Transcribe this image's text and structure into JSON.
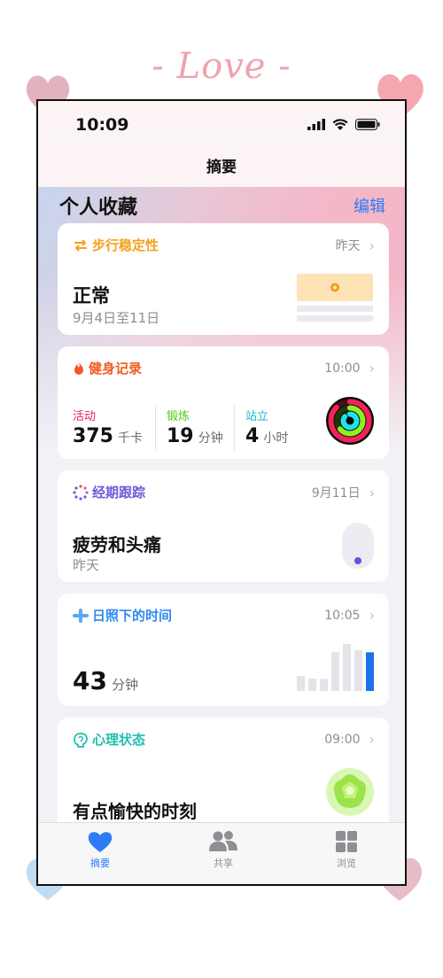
{
  "decoration": {
    "love_text": "- Love -"
  },
  "status_bar": {
    "time": "10:09"
  },
  "nav": {
    "title": "摘要"
  },
  "favorites": {
    "title": "个人收藏",
    "edit_label": "编辑"
  },
  "cards": {
    "walking": {
      "title": "步行稳定性",
      "time": "昨天",
      "value": "正常",
      "range": "9月4日至11日",
      "color": "#f4a11d"
    },
    "fitness": {
      "title": "健身记录",
      "time": "10:00",
      "color": "#f25a22",
      "move": {
        "label": "活动",
        "value": "375",
        "unit": "千卡",
        "color": "#e3245a"
      },
      "exercise": {
        "label": "锻炼",
        "value": "19",
        "unit": "分钟",
        "color": "#54c81a"
      },
      "stand": {
        "label": "站立",
        "value": "4",
        "unit": "小时",
        "color": "#1db8d4"
      }
    },
    "cycle": {
      "title": "经期跟踪",
      "time": "9月11日",
      "value": "疲劳和头痛",
      "sub": "昨天",
      "color": "#6b5bd8"
    },
    "daylight": {
      "title": "日照下的时间",
      "time": "10:05",
      "value": "43",
      "unit": "分钟",
      "color": "#2d8cf0",
      "bars": [
        0.3,
        0.25,
        0.24,
        0.78,
        0.95,
        0.82,
        0.78
      ]
    },
    "mind": {
      "title": "心理状态",
      "time": "09:00",
      "value": "有点愉快的时刻",
      "color": "#1fbfb0"
    }
  },
  "tabbar": {
    "summary": "摘要",
    "sharing": "共享",
    "browse": "浏览"
  }
}
